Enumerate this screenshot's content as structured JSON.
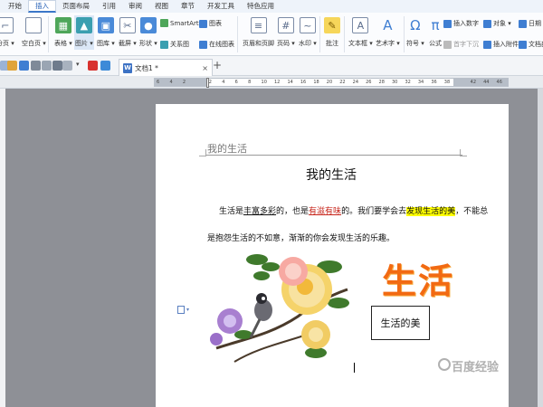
{
  "menu": [
    "开始",
    "插入",
    "页面布局",
    "引用",
    "审阅",
    "视图",
    "章节",
    "开发工具",
    "特色应用"
  ],
  "ribbon": {
    "large_buttons": [
      {
        "name": "cover-page",
        "label": "分页 ▾",
        "icon": "page-break-icon"
      },
      {
        "name": "blank-page",
        "label": "空白页 ▾",
        "icon": "blank-page-icon"
      },
      {
        "name": "table",
        "label": "表格 ▾",
        "icon": "table-icon"
      },
      {
        "name": "picture",
        "label": "图片 ▾",
        "icon": "picture-icon"
      },
      {
        "name": "gallery",
        "label": "图库 ▾",
        "icon": "gallery-icon"
      },
      {
        "name": "screenshot",
        "label": "截屏 ▾",
        "icon": "screenshot-icon"
      },
      {
        "name": "shapes",
        "label": "形状 ▾",
        "icon": "shapes-icon"
      },
      {
        "name": "header-footer",
        "label": "页眉和页脚",
        "icon": "header-footer-icon"
      },
      {
        "name": "page-number",
        "label": "页码 ▾",
        "icon": "page-number-icon"
      },
      {
        "name": "watermark",
        "label": "水印 ▾",
        "icon": "watermark-icon"
      },
      {
        "name": "comment",
        "label": "批注",
        "icon": "comment-icon"
      },
      {
        "name": "textbox",
        "label": "文本框 ▾",
        "icon": "textbox-icon"
      },
      {
        "name": "wordart",
        "label": "艺术字 ▾",
        "icon": "wordart-icon"
      },
      {
        "name": "symbol",
        "label": "符号 ▾",
        "icon": "omega-icon"
      },
      {
        "name": "formula",
        "label": "公式",
        "icon": "pi-icon"
      }
    ],
    "small_buttons": {
      "smartart": "SmartArt",
      "chart": "图表",
      "relation": "关系图",
      "online_chart": "在线图表",
      "insert_number": "插入数字",
      "object": "对象 ▾",
      "date": "日期",
      "drop_cap": "首字下沉",
      "attachment": "插入附件",
      "doc_parts": "文档部"
    }
  },
  "tab": {
    "title": "文档1 *",
    "close": "×",
    "add": "+"
  },
  "ruler": {
    "ticks": [
      "6",
      "4",
      "2",
      "",
      "2",
      "4",
      "6",
      "8",
      "10",
      "12",
      "14",
      "16",
      "18",
      "20",
      "22",
      "24",
      "26",
      "28",
      "30",
      "32",
      "34",
      "36",
      "38",
      "",
      "42",
      "44",
      "46"
    ]
  },
  "document": {
    "header": "我的生活",
    "title": "我的生活",
    "para1": {
      "a": "生活是",
      "b": "丰富多彩",
      "c": "的，也是",
      "d": "有滋有味",
      "e": "的。我们要学会去",
      "f": "发现生活的美",
      "g": "，不能总"
    },
    "para2": "是抱怨生活的不如意，渐渐的你会发现生活的乐趣。",
    "wordart": "生活",
    "textbox": "生活的美"
  },
  "watermark": "百度经验",
  "colors": {
    "accent": "#2b64b8",
    "wordart": "#f26a12",
    "highlight": "#ffff00",
    "red_text": "#c8281e"
  }
}
